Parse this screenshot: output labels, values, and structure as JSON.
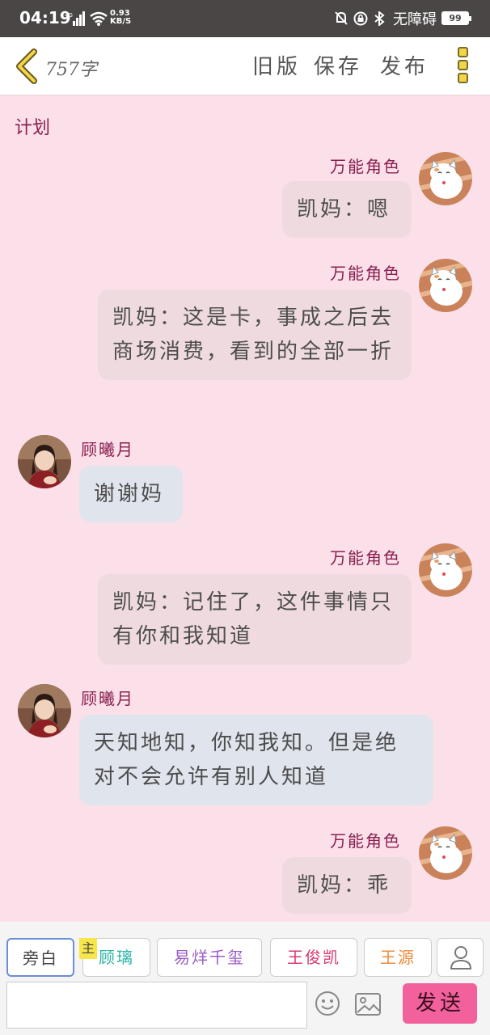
{
  "status_bar": {
    "time": "04:19",
    "network": "4G",
    "speed": "0.93",
    "speed_unit": "KB/S",
    "accessibility": "无障碍",
    "battery": "99"
  },
  "header": {
    "word_count": "757字",
    "old_version": "旧版",
    "save": "保存",
    "publish": "发布"
  },
  "chat": {
    "title": "计划",
    "messages": [
      {
        "side": "right",
        "name": "万能角色",
        "text": "凯妈：嗯",
        "avatar": "cat-avatar"
      },
      {
        "side": "right",
        "name": "万能角色",
        "text": "凯妈：这是卡，事成之后去商场消费，看到的全部一折",
        "avatar": "cat-avatar"
      },
      {
        "side": "left",
        "name": "顾曦月",
        "text": "谢谢妈",
        "avatar": "girl-avatar"
      },
      {
        "side": "right",
        "name": "万能角色",
        "text": "凯妈：记住了，这件事情只有你和我知道",
        "avatar": "cat-avatar"
      },
      {
        "side": "left",
        "name": "顾曦月",
        "text": "天知地知，你知我知。但是绝对不会允许有别人知道",
        "avatar": "girl-avatar"
      },
      {
        "side": "right",
        "name": "万能角色",
        "text": "凯妈：乖",
        "avatar": "cat-avatar"
      }
    ]
  },
  "roles": {
    "main_badge": "主",
    "items": [
      {
        "label": "旁白",
        "color": "#444444"
      },
      {
        "label": "顾璃",
        "color": "#2bb5a8"
      },
      {
        "label": "易烊千玺",
        "color": "#9a5cc6"
      },
      {
        "label": "王俊凯",
        "color": "#d83a6e"
      },
      {
        "label": "王源",
        "color": "#ef8a3a"
      }
    ]
  },
  "input": {
    "placeholder": "",
    "send": "发送"
  },
  "colors": {
    "background": "#fbe0ea",
    "name": "#8a1f4f",
    "bubble_right": "#efdbdf",
    "bubble_left": "#e0e4ed",
    "send": "#f2619b"
  }
}
